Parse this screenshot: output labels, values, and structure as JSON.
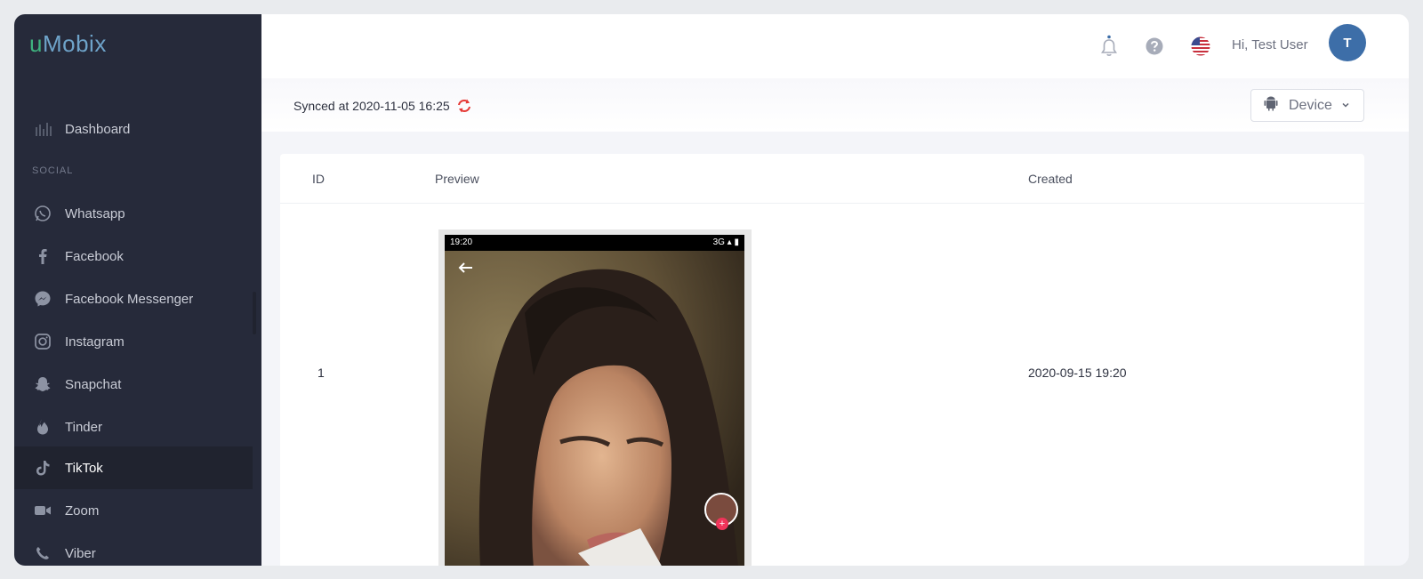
{
  "app": {
    "logo_u": "u",
    "logo_rest": "Mobix"
  },
  "sidebar": {
    "dashboard": "Dashboard",
    "section_social": "SOCIAL",
    "items": [
      {
        "label": "Whatsapp",
        "icon": "whatsapp-icon"
      },
      {
        "label": "Facebook",
        "icon": "facebook-icon"
      },
      {
        "label": "Facebook Messenger",
        "icon": "messenger-icon"
      },
      {
        "label": "Instagram",
        "icon": "instagram-icon"
      },
      {
        "label": "Snapchat",
        "icon": "snapchat-icon"
      },
      {
        "label": "Tinder",
        "icon": "tinder-icon"
      },
      {
        "label": "TikTok",
        "icon": "tiktok-icon"
      },
      {
        "label": "Zoom",
        "icon": "zoom-icon"
      },
      {
        "label": "Viber",
        "icon": "viber-icon"
      }
    ],
    "active_item": "TikTok"
  },
  "header": {
    "greeting": "Hi, Test User",
    "avatar_initial": "T"
  },
  "sync": {
    "label": "Synced at 2020-11-05 16:25"
  },
  "device_select": {
    "label": "Device"
  },
  "table": {
    "columns": [
      "ID",
      "Preview",
      "Created"
    ],
    "rows": [
      {
        "id": "1",
        "created": "2020-09-15 19:20",
        "preview": {
          "time": "19:20",
          "network": "3G"
        }
      }
    ]
  },
  "colors": {
    "sidebar_bg": "#262a3a",
    "active_bg": "#20232f",
    "avatar_bg": "#3d6ea8",
    "refresh_red": "#e53935",
    "logo_green": "#3fb27f",
    "logo_blue": "#6ea3c9"
  }
}
